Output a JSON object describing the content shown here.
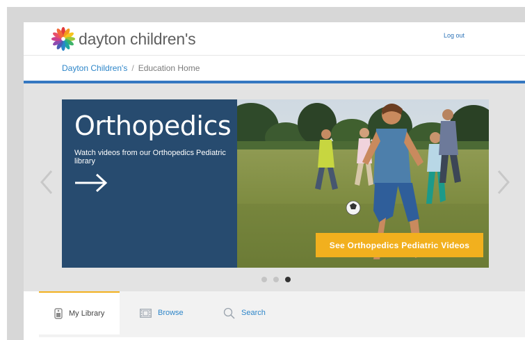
{
  "header": {
    "logo_text": "dayton children's",
    "logout_label": "Log out"
  },
  "breadcrumb": {
    "home_label": "Dayton Children's",
    "separator": "/",
    "current_label": "Education Home"
  },
  "carousel": {
    "title": "Orthopedics",
    "subtitle": "Watch videos from our Orthopedics Pediatric library",
    "cta_label": "See Orthopedics Pediatric Videos",
    "slide_count": 3,
    "active_slide": 3
  },
  "tabs": [
    {
      "label": "My Library",
      "icon": "library-card-icon",
      "active": true
    },
    {
      "label": "Browse",
      "icon": "film-strip-icon",
      "active": false
    },
    {
      "label": "Search",
      "icon": "magnifier-icon",
      "active": false
    }
  ],
  "colors": {
    "brand_blue": "#3577c1",
    "slide_panel": "#274b6f",
    "cta_yellow": "#f2b01e",
    "link_blue": "#2e86c9"
  }
}
